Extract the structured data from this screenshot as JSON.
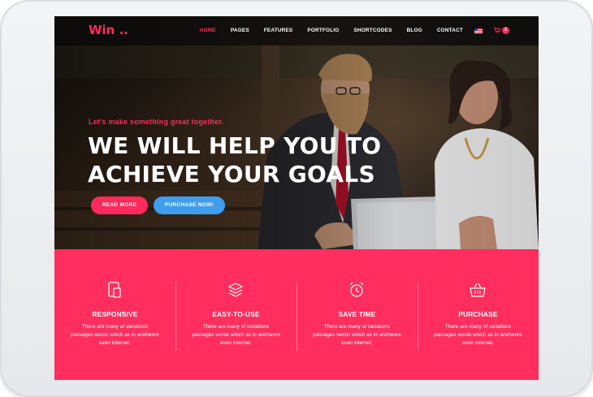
{
  "nav": {
    "logo": "Win ..",
    "items": [
      "HOME",
      "PAGES",
      "FEATURES",
      "PORTFOLIO",
      "SHORTCODES",
      "BLOG",
      "CONTACT"
    ],
    "cart_count": "2"
  },
  "hero": {
    "tagline": "Let's make something great together.",
    "headline_line1": "WE WILL HELP YOU TO",
    "headline_line2": "ACHIEVE YOUR GOALS",
    "read_more": "READ MORE",
    "purchase": "PURCHASE NOW!"
  },
  "features": [
    {
      "title": "RESPONSIVE",
      "desc": "There are many of variations passages words which as in arethenre even internet.",
      "icon": "devices-icon"
    },
    {
      "title": "EASY-TO-USE",
      "desc": "There are many of variations passages words which as in arethenre even internet.",
      "icon": "layers-icon"
    },
    {
      "title": "SAVE TIME",
      "desc": "There are many of variations passages words which as in arethenre even internet.",
      "icon": "alarm-clock-icon"
    },
    {
      "title": "PURCHASE",
      "desc": "There are many of variations passages words which as in arethenre even internet.",
      "icon": "basket-icon"
    }
  ],
  "colors": {
    "accent": "#ff2a5b",
    "secondary": "#3f9df0",
    "features_bg": "#ff2e5e"
  }
}
